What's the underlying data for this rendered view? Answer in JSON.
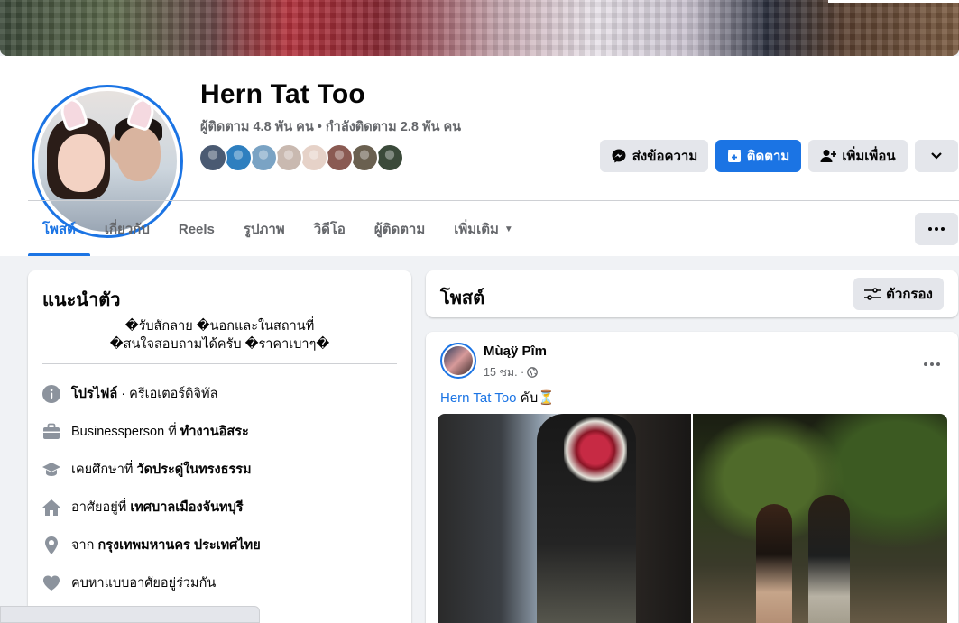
{
  "profile": {
    "name": "Hern Tat Too",
    "stats": "ผู้ติดตาม 4.8 พัน คน • กำลังติดตาม 2.8 พัน คน",
    "friend_colors": [
      "#4a5a72",
      "#2e7fbf",
      "#7aa3c4",
      "#c9b9b0",
      "#e6d2c8",
      "#8a5a52",
      "#6a6050",
      "#3b4a3a"
    ]
  },
  "actions": {
    "message": "ส่งข้อความ",
    "follow": "ติดตาม",
    "add_friend": "เพิ่มเพื่อน"
  },
  "tabs": [
    {
      "label": "โพสต์"
    },
    {
      "label": "เกี่ยวกับ"
    },
    {
      "label": "Reels"
    },
    {
      "label": "รูปภาพ"
    },
    {
      "label": "วิดีโอ"
    },
    {
      "label": "ผู้ติดตาม"
    },
    {
      "label": "เพิ่มเติม"
    }
  ],
  "intro": {
    "title": "แนะนำตัว",
    "bio_line1": "�รับสักลาย �นอกและในสถานที่",
    "bio_line2": "�สนใจสอบถามได้ครับ �ราคาเบาๆ�",
    "rows": [
      {
        "icon": "info-icon",
        "bold_first": "โปรไฟล์",
        "rest": " · ครีเอเตอร์ดิจิทัล"
      },
      {
        "icon": "briefcase-icon",
        "prefix": "Businessperson ที่ ",
        "bold": "ทำงานอิสระ"
      },
      {
        "icon": "graduation-cap-icon",
        "prefix": "เคยศึกษาที่ ",
        "bold": "วัดประดู่ในทรงธรรม"
      },
      {
        "icon": "home-icon",
        "prefix": "อาศัยอยู่ที่ ",
        "bold": "เทศบาลเมืองจันทบุรี"
      },
      {
        "icon": "location-pin-icon",
        "prefix": "จาก ",
        "bold": "กรุงเทพมหานคร ประเทศไทย"
      },
      {
        "icon": "heart-icon",
        "prefix": "คบหาแบบอาศัยอยู่ร่วมกัน",
        "bold": ""
      }
    ]
  },
  "posts_header": {
    "title": "โพสต์",
    "filter": "ตัวกรอง"
  },
  "post": {
    "author": "Mùąÿ Pîm",
    "time": "15 ชม. ·",
    "tag": "Hern Tat Too",
    "text": " คับ⏳"
  }
}
